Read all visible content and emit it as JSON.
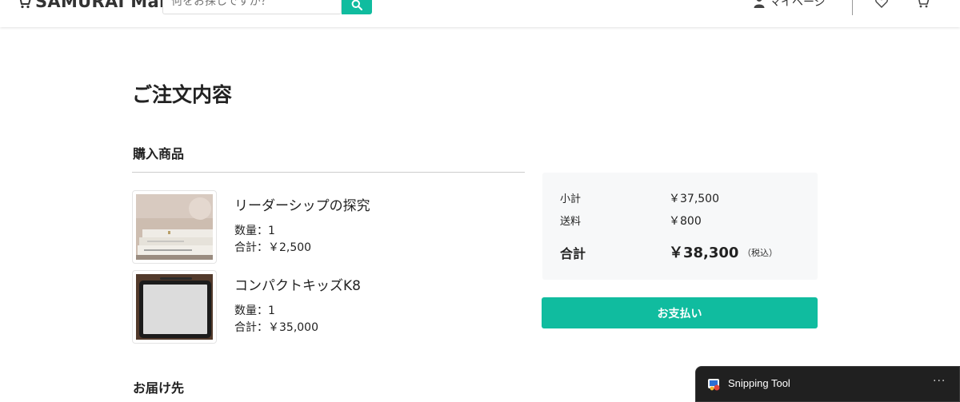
{
  "header": {
    "logo_text": "SAMURAI Mart",
    "search_placeholder": "何をお探しですか？",
    "mypage_label": "マイページ"
  },
  "page": {
    "title": "ご注文内容",
    "purchase_section_title": "購入商品",
    "delivery_section_title": "お届け先"
  },
  "items": [
    {
      "name": "リーダーシップの探究",
      "qty": "数量：1",
      "total": "合計：￥2,500"
    },
    {
      "name": "コンパクトキッズK8",
      "qty": "数量：1",
      "total": "合計：￥35,000"
    }
  ],
  "summary": {
    "subtotal_label": "小計",
    "subtotal_value": "￥37,500",
    "shipping_label": "送料",
    "shipping_value": "￥800",
    "total_label": "合計",
    "total_value": "￥38,300",
    "tax_note": "（税込）"
  },
  "pay_button_label": "お支払い",
  "toast": {
    "app_name": "Snipping Tool",
    "more": "···"
  },
  "colors": {
    "accent": "#10bc9f",
    "summary_bg": "#f7f8f9",
    "toast_bg": "#202020"
  }
}
